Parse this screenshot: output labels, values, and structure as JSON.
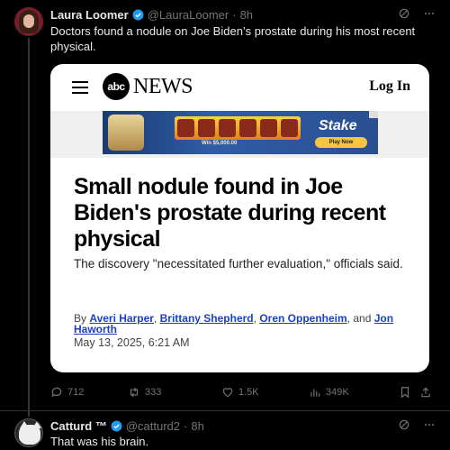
{
  "tweet1": {
    "author_name": "Laura Loomer",
    "handle": "@LauraLoomer",
    "separator": "·",
    "time": "8h",
    "text": "Doctors found a nodule on Joe Biden’s prostate during his most recent physical.",
    "card": {
      "brand_logo": "abc",
      "brand_word": "NEWS",
      "login_label": "Log In",
      "ad": {
        "brand": "Stake",
        "cta": "Play Now",
        "win_text": "Win $5,000.00"
      },
      "headline": "Small nodule found in Joe Biden's prostate during recent physical",
      "subtitle": "The discovery \"necessitated further evaluation,\" officials said.",
      "byline_prefix": "By",
      "authors": [
        "Averi Harper",
        "Brittany Shepherd",
        "Oren Oppenheim",
        "Jon Haworth"
      ],
      "and_word": "and",
      "date": "May 13, 2025, 6:21 AM"
    },
    "actions": {
      "replies": "712",
      "reposts": "333",
      "likes": "1.5K",
      "views": "349K"
    }
  },
  "tweet2": {
    "author_name": "Catturd ™",
    "handle": "@catturd2",
    "separator": "·",
    "time": "8h",
    "text": "That was his brain."
  },
  "colors": {
    "background": "#000000",
    "muted": "#71767b",
    "verified": "#1d9bf0",
    "link": "#1d3ec7"
  },
  "icons": [
    "verified-badge-icon",
    "grok-icon",
    "more-icon",
    "hamburger-icon",
    "reply-icon",
    "repost-icon",
    "like-icon",
    "views-icon",
    "bookmark-icon",
    "share-icon"
  ]
}
